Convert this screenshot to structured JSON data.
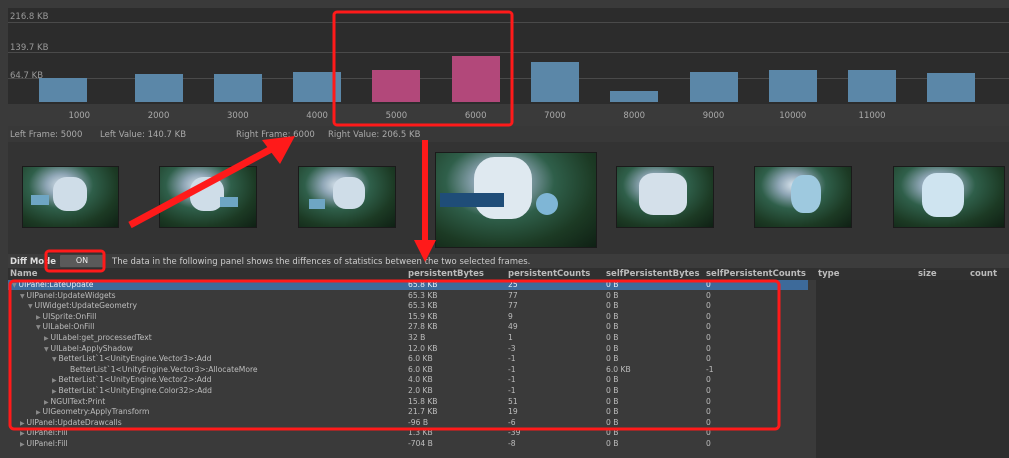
{
  "chart_data": {
    "type": "bar",
    "y_ticks": [
      "216.8 KB",
      "139.7 KB",
      "64.7 KB"
    ],
    "x_ticks": [
      "1000",
      "2000",
      "3000",
      "4000",
      "5000",
      "6000",
      "7000",
      "8000",
      "9000",
      "10000",
      "11000"
    ],
    "bars": [
      {
        "frame": 800,
        "value_kb": 58,
        "selected": false
      },
      {
        "frame": 2000,
        "value_kb": 68,
        "selected": false
      },
      {
        "frame": 3000,
        "value_kb": 68,
        "selected": false
      },
      {
        "frame": 4000,
        "value_kb": 74,
        "selected": false
      },
      {
        "frame": 5000,
        "value_kb": 78,
        "selected": true
      },
      {
        "frame": 6000,
        "value_kb": 112,
        "selected": true
      },
      {
        "frame": 7000,
        "value_kb": 98,
        "selected": false
      },
      {
        "frame": 8000,
        "value_kb": 26,
        "selected": false
      },
      {
        "frame": 9000,
        "value_kb": 73,
        "selected": false
      },
      {
        "frame": 10000,
        "value_kb": 78,
        "selected": false
      },
      {
        "frame": 11000,
        "value_kb": 78,
        "selected": false
      },
      {
        "frame": 12000,
        "value_kb": 72,
        "selected": false
      }
    ],
    "x_range": [
      0,
      12500
    ],
    "y_range": [
      0,
      230
    ],
    "colors": {
      "bar": "#5b87a8",
      "selected": "#b2487a"
    }
  },
  "info": {
    "left_frame": "Left Frame: 5000",
    "left_value": "Left Value: 140.7 KB",
    "right_frame": "Right Frame: 6000",
    "right_value": "Right Value: 206.5 KB"
  },
  "diff": {
    "label": "Diff Mode",
    "button": "ON",
    "description": "The data in the following panel shows the diffences of statistics between the two selected frames."
  },
  "columns": [
    "Name",
    "persistentBytes",
    "persistentCounts",
    "selfPersistentBytes",
    "selfPersistentCounts",
    "type",
    "size",
    "count"
  ],
  "rows": [
    {
      "name": "UIPanel:LateUpdate",
      "depth": 0,
      "expanded": true,
      "bytes": "65.8 KB",
      "counts": "25",
      "selfBytes": "0 B",
      "selfCounts": "0",
      "selected": true
    },
    {
      "name": "UIPanel:UpdateWidgets",
      "depth": 1,
      "expanded": true,
      "bytes": "65.3 KB",
      "counts": "77",
      "selfBytes": "0 B",
      "selfCounts": "0"
    },
    {
      "name": "UIWidget:UpdateGeometry",
      "depth": 2,
      "expanded": true,
      "bytes": "65.3 KB",
      "counts": "77",
      "selfBytes": "0 B",
      "selfCounts": "0"
    },
    {
      "name": "UISprite:OnFill",
      "depth": 3,
      "expanded": false,
      "bytes": "15.9 KB",
      "counts": "9",
      "selfBytes": "0 B",
      "selfCounts": "0"
    },
    {
      "name": "UILabel:OnFill",
      "depth": 3,
      "expanded": true,
      "bytes": "27.8 KB",
      "counts": "49",
      "selfBytes": "0 B",
      "selfCounts": "0"
    },
    {
      "name": "UILabel:get_processedText",
      "depth": 4,
      "expanded": false,
      "bytes": "32 B",
      "counts": "1",
      "selfBytes": "0 B",
      "selfCounts": "0"
    },
    {
      "name": "UILabel:ApplyShadow",
      "depth": 4,
      "expanded": true,
      "bytes": "12.0 KB",
      "counts": "-3",
      "selfBytes": "0 B",
      "selfCounts": "0"
    },
    {
      "name": "BetterList`1<UnityEngine.Vector3>:Add",
      "depth": 5,
      "expanded": true,
      "bytes": "6.0 KB",
      "counts": "-1",
      "selfBytes": "0 B",
      "selfCounts": "0"
    },
    {
      "name": "BetterList`1<UnityEngine.Vector3>:AllocateMore",
      "depth": 6,
      "leaf": true,
      "bytes": "6.0 KB",
      "counts": "-1",
      "selfBytes": "6.0 KB",
      "selfCounts": "-1"
    },
    {
      "name": "BetterList`1<UnityEngine.Vector2>:Add",
      "depth": 5,
      "expanded": false,
      "bytes": "4.0 KB",
      "counts": "-1",
      "selfBytes": "0 B",
      "selfCounts": "0"
    },
    {
      "name": "BetterList`1<UnityEngine.Color32>:Add",
      "depth": 5,
      "expanded": false,
      "bytes": "2.0 KB",
      "counts": "-1",
      "selfBytes": "0 B",
      "selfCounts": "0"
    },
    {
      "name": "NGUIText:Print",
      "depth": 4,
      "expanded": false,
      "bytes": "15.8 KB",
      "counts": "51",
      "selfBytes": "0 B",
      "selfCounts": "0"
    },
    {
      "name": "UIGeometry:ApplyTransform",
      "depth": 3,
      "expanded": false,
      "bytes": "21.7 KB",
      "counts": "19",
      "selfBytes": "0 B",
      "selfCounts": "0"
    },
    {
      "name": "UIPanel:UpdateDrawcalls",
      "depth": 1,
      "expanded": false,
      "bytes": "-96 B",
      "counts": "-6",
      "selfBytes": "0 B",
      "selfCounts": "0"
    },
    {
      "name": "UIPanel:Fill",
      "depth": 1,
      "expanded": false,
      "bytes": "1.3 KB",
      "counts": "-39",
      "selfBytes": "0 B",
      "selfCounts": "0"
    },
    {
      "name": "UIPanel:Fill",
      "depth": 1,
      "expanded": false,
      "bytes": "-704 B",
      "counts": "-8",
      "selfBytes": "0 B",
      "selfCounts": "0"
    }
  ],
  "icons": {
    "expanded": "triangle-down-icon",
    "collapsed": "triangle-right-icon"
  },
  "colors": {
    "annotation": "#ff1a1a",
    "selection": "#3d6a9a"
  }
}
